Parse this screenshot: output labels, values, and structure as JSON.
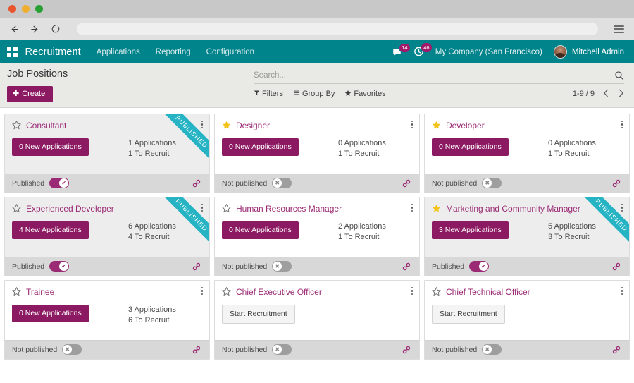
{
  "browser": {
    "back_icon": "arrow-left-icon",
    "forward_icon": "arrow-right-icon",
    "reload_icon": "reload-icon",
    "url_value": "",
    "menu_icon": "hamburger-menu-icon"
  },
  "navbar": {
    "apps_icon": "apps-grid-icon",
    "brand": "Recruitment",
    "menu_items": [
      {
        "label": "Applications"
      },
      {
        "label": "Reporting"
      },
      {
        "label": "Configuration"
      }
    ],
    "messages_icon": "chat-bubble-icon",
    "messages_count": "14",
    "activities_icon": "clock-icon",
    "activities_count": "46",
    "company": "My Company (San Francisco)",
    "avatar_icon": "user-avatar",
    "user": "Mitchell Admin",
    "accent_color": "#00848c",
    "badge_color": "#a2186b"
  },
  "control_panel": {
    "title": "Job Positions",
    "create_label": "Create",
    "create_icon": "plus-icon",
    "create_color": "#8c1a62",
    "search": {
      "placeholder": "Search...",
      "value": "",
      "icon": "search-icon"
    },
    "filters": [
      {
        "label": "Filters",
        "icon": "filter-icon"
      },
      {
        "label": "Group By",
        "icon": "list-icon"
      },
      {
        "label": "Favorites",
        "icon": "star-icon"
      }
    ],
    "pager": {
      "count": "1-9 / 9",
      "prev_icon": "chevron-left-icon",
      "next_icon": "chevron-right-icon"
    }
  },
  "kanban": {
    "ribbon_label": "PUBLISHED",
    "ribbon_color": "#26b4c4",
    "published_label": "Published",
    "not_published_label": "Not published",
    "link_icon": "chain-link-icon",
    "menu_icon": "kebab-menu-icon",
    "star_filled_icon": "star-filled-icon",
    "star_empty_icon": "star-outline-icon",
    "start_recruitment_label": "Start Recruitment",
    "cards": [
      {
        "title": "Consultant",
        "favorite": false,
        "published": true,
        "new_applications": "0 New Applications",
        "applications": "1 Applications",
        "to_recruit": "1 To Recruit",
        "status_label": "Published"
      },
      {
        "title": "Designer",
        "favorite": true,
        "published": false,
        "new_applications": "0 New Applications",
        "applications": "0 Applications",
        "to_recruit": "1 To Recruit",
        "status_label": "Not published"
      },
      {
        "title": "Developer",
        "favorite": true,
        "published": false,
        "new_applications": "0 New Applications",
        "applications": "0 Applications",
        "to_recruit": "1 To Recruit",
        "status_label": "Not published"
      },
      {
        "title": "Experienced Developer",
        "favorite": false,
        "published": true,
        "new_applications": "4 New Applications",
        "applications": "6 Applications",
        "to_recruit": "4 To Recruit",
        "status_label": "Published"
      },
      {
        "title": "Human Resources Manager",
        "favorite": false,
        "published": false,
        "new_applications": "0 New Applications",
        "applications": "2 Applications",
        "to_recruit": "1 To Recruit",
        "status_label": "Not published"
      },
      {
        "title": "Marketing and Community Manager",
        "favorite": true,
        "published": true,
        "new_applications": "3 New Applications",
        "applications": "5 Applications",
        "to_recruit": "3 To Recruit",
        "status_label": "Published"
      },
      {
        "title": "Trainee",
        "favorite": false,
        "published": false,
        "new_applications": "0 New Applications",
        "applications": "3 Applications",
        "to_recruit": "6 To Recruit",
        "status_label": "Not published"
      },
      {
        "title": "Chief Executive Officer",
        "favorite": false,
        "published": false,
        "start_recruitment": "Start Recruitment",
        "status_label": "Not published"
      },
      {
        "title": "Chief Technical Officer",
        "favorite": false,
        "published": false,
        "start_recruitment": "Start Recruitment",
        "status_label": "Not published"
      }
    ]
  }
}
